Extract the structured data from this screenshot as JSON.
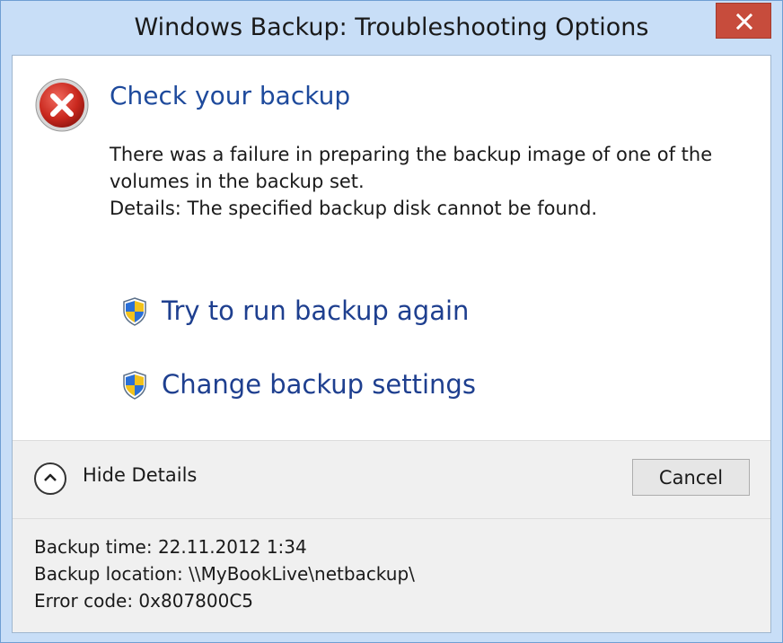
{
  "window": {
    "title": "Windows Backup: Troubleshooting Options",
    "close_icon": "close-icon"
  },
  "main": {
    "icon": "error-icon",
    "instruction": "Check your backup",
    "message_lines": [
      "There was a failure in preparing the backup image of one of the",
      "volumes in the backup set.",
      "Details: The specified backup disk cannot be found."
    ]
  },
  "commands": [
    {
      "label": "Try to run backup again",
      "icon": "uac-shield-icon"
    },
    {
      "label": "Change backup settings",
      "icon": "uac-shield-icon"
    }
  ],
  "footer": {
    "expando_label": "Hide Details",
    "expando_icon": "chevron-up-icon",
    "cancel_label": "Cancel"
  },
  "details": {
    "lines": [
      "Backup time: 22.11.2012 1:34",
      "Backup location: \\\\MyBookLive\\netbackup\\",
      "Error code: 0x807800C5"
    ]
  },
  "colors": {
    "frame": "#c8def7",
    "main_instruction": "#1e4a9c",
    "close_button": "#c74c3c",
    "footer_bg": "#f0f0f0"
  }
}
